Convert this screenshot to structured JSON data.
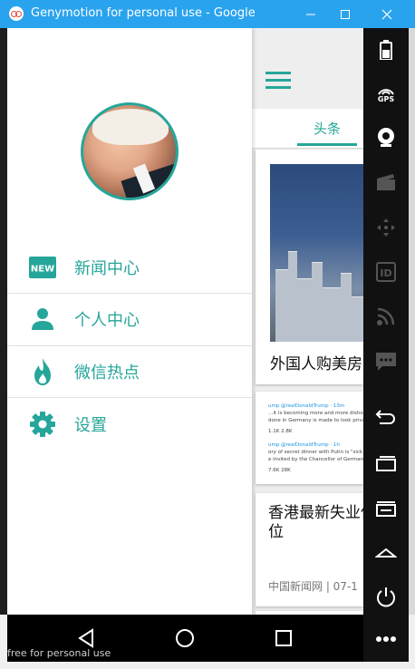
{
  "window": {
    "title": "Genymotion for personal use - Google Nexu...",
    "watermark": "free for personal use"
  },
  "main": {
    "tab_label": "头条",
    "cards": {
      "first_title": "外国人购美房",
      "tweet_lines": [
        "ump @realDonaldTrump · 13m",
        "…it is becoming more and more dishonest",
        "done in Germany is made to look private?",
        "1.1K   2.8K",
        "ump @realDonaldTrump · 1h",
        "ory of secret dinner with Putin is \"sick.\" All",
        "e invited by the Chancellor of Germany, Pu",
        "7.6K   28K"
      ],
      "third_title": "香港最新失业低位",
      "third_meta": "中国新闻网 | 07-1"
    }
  },
  "drawer": {
    "menu": [
      {
        "label": "新闻中心",
        "icon": "new-badge-icon"
      },
      {
        "label": "个人中心",
        "icon": "person-icon"
      },
      {
        "label": "微信热点",
        "icon": "flame-icon"
      },
      {
        "label": "设置",
        "icon": "gear-icon"
      }
    ]
  },
  "toolbar": {
    "gps_label": "GPS",
    "id_label": "ID"
  },
  "colors": {
    "accent": "#26a69a",
    "titlebar": "#2aa3ee",
    "toolbar": "#111111"
  }
}
